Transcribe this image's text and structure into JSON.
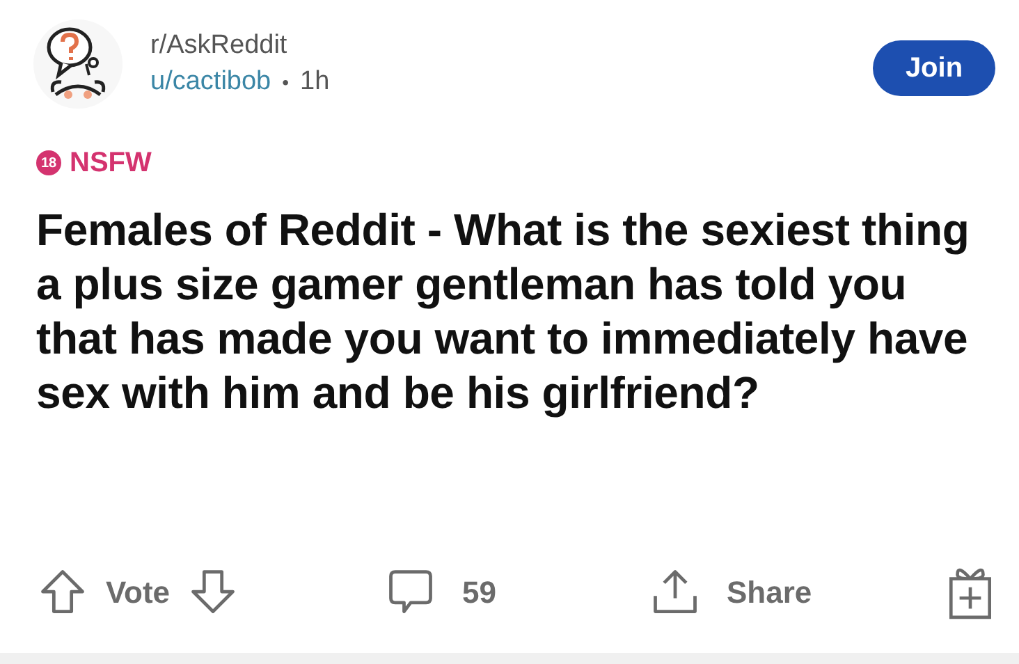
{
  "post": {
    "subreddit": "r/AskReddit",
    "author": "u/cactibob",
    "separator": "•",
    "age": "1h",
    "join_label": "Join",
    "nsfw": {
      "badge": "18",
      "label": "NSFW"
    },
    "title": "Females of Reddit - What is the sexiest thing a plus size gamer gentleman has told you that has made you want to immediately have sex with him and be his girlfriend?"
  },
  "actions": {
    "vote_label": "Vote",
    "comments": "59",
    "share_label": "Share"
  }
}
